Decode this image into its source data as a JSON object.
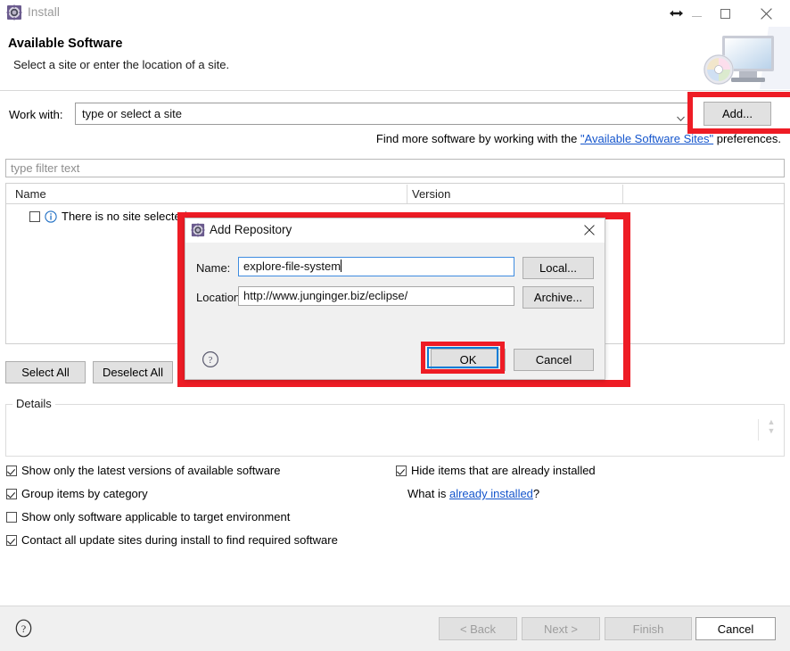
{
  "window": {
    "title": "Install",
    "icon": "install-gear-icon",
    "controls": {
      "resize": "resize-horizontal-icon",
      "minimize": "minimize-icon",
      "maximize": "maximize-icon",
      "close": "close-icon"
    }
  },
  "header": {
    "title": "Available Software",
    "subtitle": "Select a site or enter the location of a site.",
    "banner_icon": "monitor-cd-icon"
  },
  "work_with": {
    "label": "Work with:",
    "value": "type or select a site",
    "placeholder": "type or select a site",
    "dropdown_icon": "chevron-down-icon",
    "add_button": "Add..."
  },
  "find_more": {
    "prefix": "Find more software by working with the ",
    "link": "\"Available Software Sites\"",
    "suffix": " preferences."
  },
  "filter": {
    "placeholder": "type filter text",
    "value": ""
  },
  "table": {
    "columns": [
      "Name",
      "Version"
    ],
    "rows": [
      {
        "checked": false,
        "icon": "info-icon",
        "name": "There is no site selected",
        "version": ""
      }
    ]
  },
  "selection_buttons": {
    "select_all": "Select All",
    "deselect_all": "Deselect All"
  },
  "details": {
    "label": "Details",
    "content": "",
    "scroll_icon": "scroll-up-down-icon"
  },
  "options": {
    "left": [
      {
        "label": "Show only the latest versions of available software",
        "checked": true
      },
      {
        "label": "Group items by category",
        "checked": true
      },
      {
        "label": "Show only software applicable to target environment",
        "checked": false
      },
      {
        "label": "Contact all update sites during install to find required software",
        "checked": true
      }
    ],
    "right": [
      {
        "label": "Hide items that are already installed",
        "checked": true
      }
    ],
    "what_is": {
      "prefix": "What is ",
      "link": "already installed",
      "suffix": "?"
    }
  },
  "wizard_buttons": {
    "help_icon": "help-question-icon",
    "back": "< Back",
    "next": "Next >",
    "finish": "Finish",
    "cancel": "Cancel",
    "back_enabled": false,
    "next_enabled": false,
    "finish_enabled": false,
    "cancel_enabled": true
  },
  "dialog": {
    "title": "Add Repository",
    "icon": "install-gear-icon",
    "close_icon": "close-icon",
    "name_label": "Name:",
    "name_value": "explore-file-system",
    "location_label": "Location:",
    "location_value": "http://www.junginger.biz/eclipse/",
    "local_button": "Local...",
    "archive_button": "Archive...",
    "ok_button": "OK",
    "cancel_button": "Cancel",
    "help_icon": "help-question-icon"
  },
  "highlights": {
    "color": "#ee1c25",
    "focus_color": "#0a7cd6",
    "targets": [
      "add-button",
      "add-repository-dialog",
      "ok-button"
    ]
  }
}
